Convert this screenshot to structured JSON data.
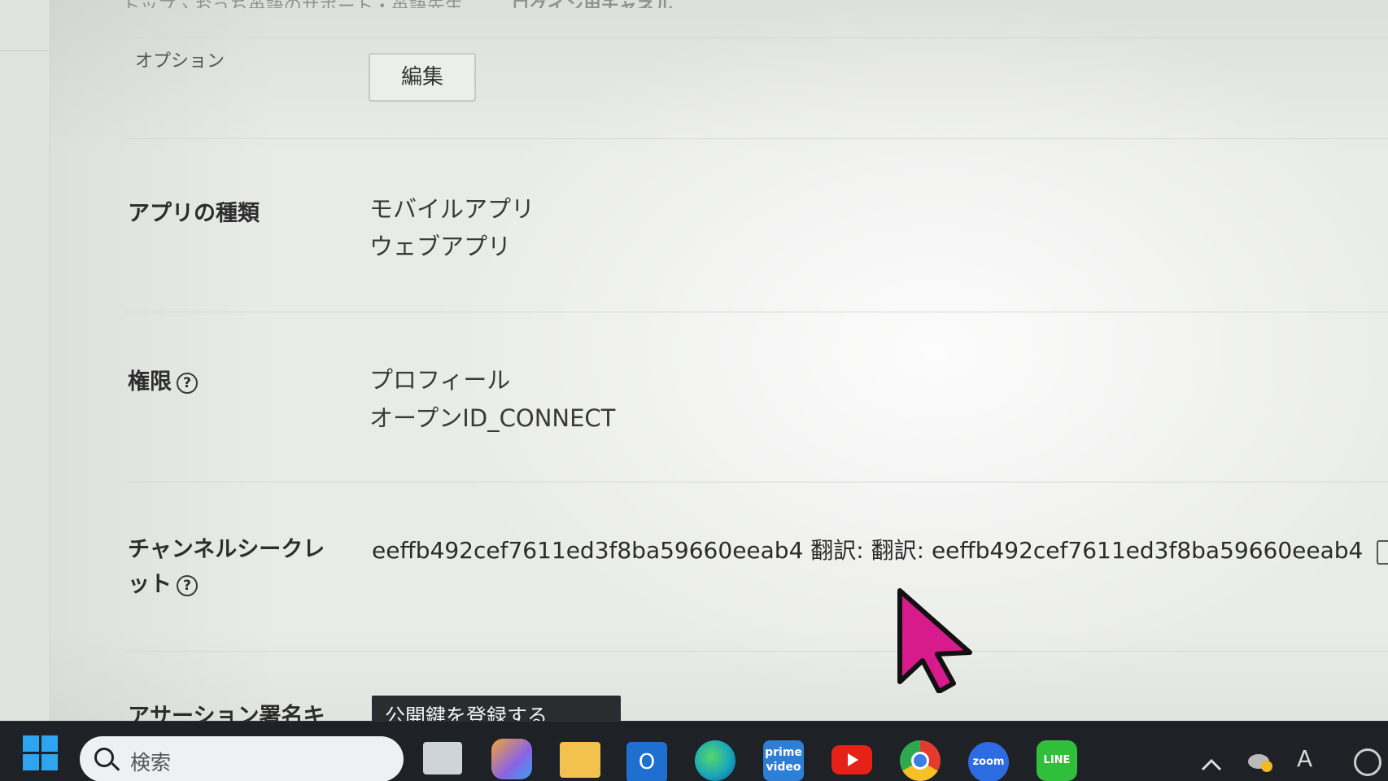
{
  "breadcrumb_partial": "トップ › おうち英語のサポート・英語先生",
  "breadcrumb_right": "ログイン用チャネル",
  "option": {
    "label": "オプション",
    "edit_button": "編集"
  },
  "app_type": {
    "label": "アプリの種類",
    "values": [
      "モバイルアプリ",
      "ウェブアプリ"
    ]
  },
  "permissions": {
    "label": "権限",
    "values": [
      "プロフィール",
      "オープンID_CONNECT"
    ]
  },
  "channel_secret": {
    "label_line1": "チャンネルシークレ",
    "label_line2": "ット",
    "value": "eeffb492cef7611ed3f8ba59660eeab4 翻訳: 翻訳: eeffb492cef7611ed3f8ba59660eeab4"
  },
  "assertion": {
    "label": "アサーション署名キ",
    "button": "公開鍵を登録する"
  },
  "help_glyph": "?",
  "taskbar": {
    "search_placeholder": "検索",
    "apps": [
      {
        "name": "task-view",
        "color": "#cfd4d8"
      },
      {
        "name": "copilot",
        "color": "#8a63e6"
      },
      {
        "name": "file-explorer",
        "color": "#f2c14e"
      },
      {
        "name": "outlook",
        "color": "#1f6fd1"
      },
      {
        "name": "edge",
        "color": "#1aa7b7"
      },
      {
        "name": "prime-video",
        "color": "#2d7fd6"
      },
      {
        "name": "youtube",
        "color": "#e62117"
      },
      {
        "name": "chrome",
        "color": "#e6b21a"
      },
      {
        "name": "zoom",
        "color": "#2d6be2"
      },
      {
        "name": "line",
        "color": "#2fbf3a"
      }
    ],
    "prime_label": "prime video",
    "zoom_label": "zoom",
    "line_label": "LINE",
    "ime_label": "A"
  },
  "colors": {
    "cursor": "#d81b8c",
    "taskbar": "#1e2226"
  }
}
